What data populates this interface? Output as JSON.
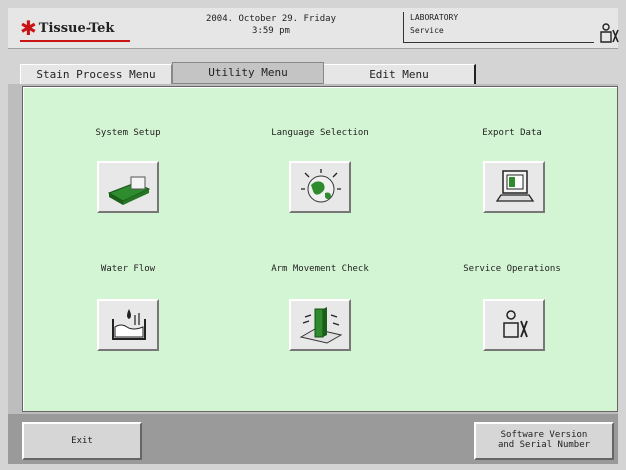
{
  "header": {
    "brand": "Tissue-Tek",
    "date": "2004. October 29. Friday",
    "time": "3:59 pm",
    "location": "LABORATORY",
    "mode": "Service"
  },
  "tabs": [
    {
      "label": "Stain Process Menu"
    },
    {
      "label": "Utility Menu"
    },
    {
      "label": "Edit Menu"
    }
  ],
  "items": [
    {
      "label": "System Setup",
      "icon": "system-setup-icon"
    },
    {
      "label": "Language Selection",
      "icon": "globe-icon"
    },
    {
      "label": "Export Data",
      "icon": "computer-icon"
    },
    {
      "label": "Water Flow",
      "icon": "water-flow-icon"
    },
    {
      "label": "Arm Movement Check",
      "icon": "arm-movement-icon"
    },
    {
      "label": "Service Operations",
      "icon": "lock-person-icon"
    }
  ],
  "buttons": {
    "exit": "Exit",
    "software_line1": "Software Version",
    "software_line2": "and Serial Number"
  },
  "colors": {
    "panel_bg": "#d4f5d4",
    "brand_red": "#c81414"
  }
}
